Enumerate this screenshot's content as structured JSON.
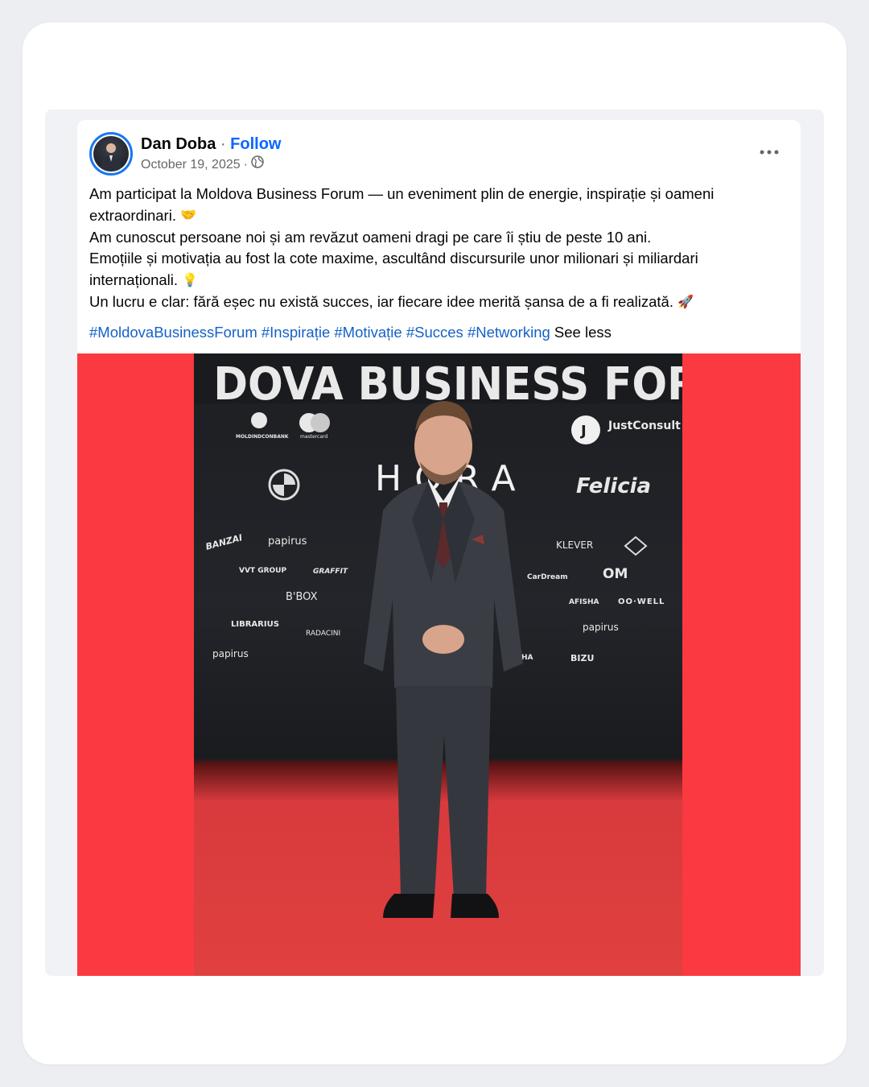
{
  "post": {
    "author": "Dan Doba",
    "separator": "·",
    "follow_label": "Follow",
    "date": "October 19, 2025",
    "date_separator": "·",
    "audience_icon": "globe-icon",
    "more_icon": "more-horizontal-icon",
    "text_lines": [
      "Am participat la Moldova Business Forum — un eveniment plin de energie, inspirație și oameni extraordinari.",
      "Am cunoscut persoane noi și am revăzut oameni dragi pe care îi știu de peste 10 ani.",
      "Emoțiile și motivația au fost la cote maxime, ascultând discursurile unor milionari și miliardari internaționali.",
      "Un lucru e clar: fără eșec nu există succes, iar fiecare idee merită șansa de a fi realizată."
    ],
    "emojis": [
      "🤝",
      "💡",
      "🚀"
    ],
    "hashtags": [
      "#MoldovaBusinessForum",
      "#Inspirație",
      "#Motivație",
      "#Succes",
      "#Networking"
    ],
    "see_less_label": "See less"
  },
  "photo": {
    "banner": "DOVA BUSINESS FOR",
    "logos": {
      "justconsult": "JustConsult",
      "felicia": "Felicia",
      "hora": "HORA",
      "papirus_1": "papirus",
      "papirus_2": "papirus",
      "papirus_3": "papirus",
      "klever": "KLEVER",
      "librarius": "LIBRARIUS",
      "om": "OM",
      "afisha_1": "AFISHA",
      "afisha_2": "AFISHA",
      "oowell": "OO·WELL",
      "bbox": "B'BOX",
      "bizu": "BIZU",
      "vvt": "VVT GROUP",
      "graffit": "GRAFFIT",
      "banzai": "BANZAI",
      "cardream": "CarDream",
      "radacini": "RADACINI",
      "moldindconbank": "MOLDINDCONBANK",
      "mastercard": "mastercard"
    }
  },
  "colors": {
    "accent": "#0866ff",
    "hashtag": "#1461c9",
    "media_bg": "#fb3940"
  }
}
